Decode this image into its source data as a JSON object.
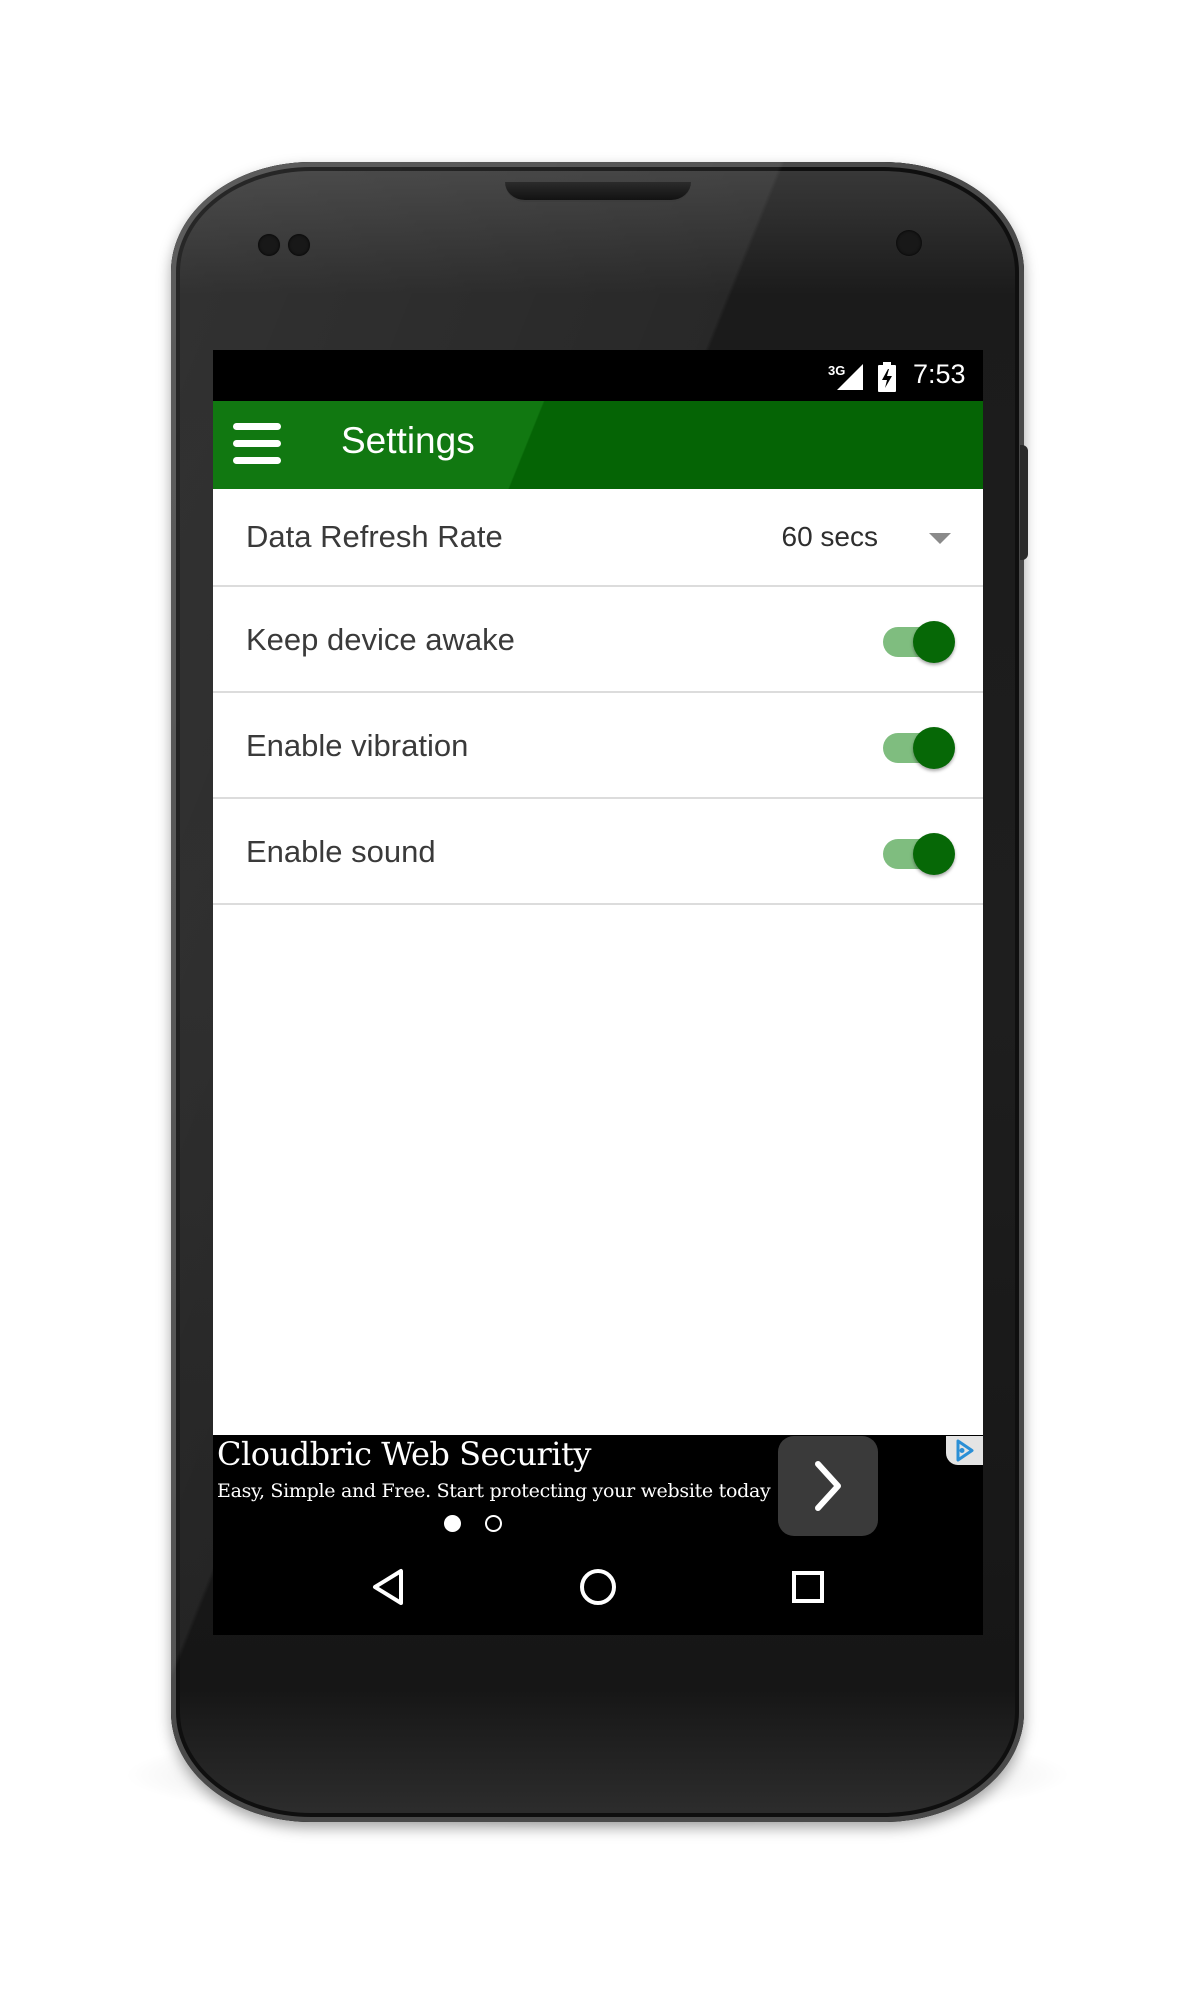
{
  "status_bar": {
    "network": "3G",
    "time": "7:53",
    "signal_icon": "cell-signal-icon",
    "battery_icon": "battery-charging-icon"
  },
  "app_bar": {
    "menu_icon": "hamburger-menu-icon",
    "title": "Settings",
    "color": "#117811"
  },
  "settings": {
    "refresh_rate": {
      "label": "Data Refresh Rate",
      "value": "60 secs",
      "icon": "dropdown-arrow-icon"
    },
    "toggles": [
      {
        "label": "Keep device awake",
        "on": true
      },
      {
        "label": "Enable vibration",
        "on": true
      },
      {
        "label": "Enable sound",
        "on": true
      }
    ],
    "toggle_on_color": "#066806",
    "toggle_track_color": "#7fbd7f"
  },
  "ad": {
    "title": "Cloudbric Web Security",
    "subtitle": "Easy, Simple and Free. Start protecting your website today",
    "pager_current": 1,
    "pager_total": 2,
    "go_icon": "chevron-right-icon",
    "choices_icon": "adchoices-icon"
  },
  "nav_bar": {
    "back_icon": "back-triangle-icon",
    "home_icon": "home-circle-icon",
    "recents_icon": "recents-square-icon"
  }
}
